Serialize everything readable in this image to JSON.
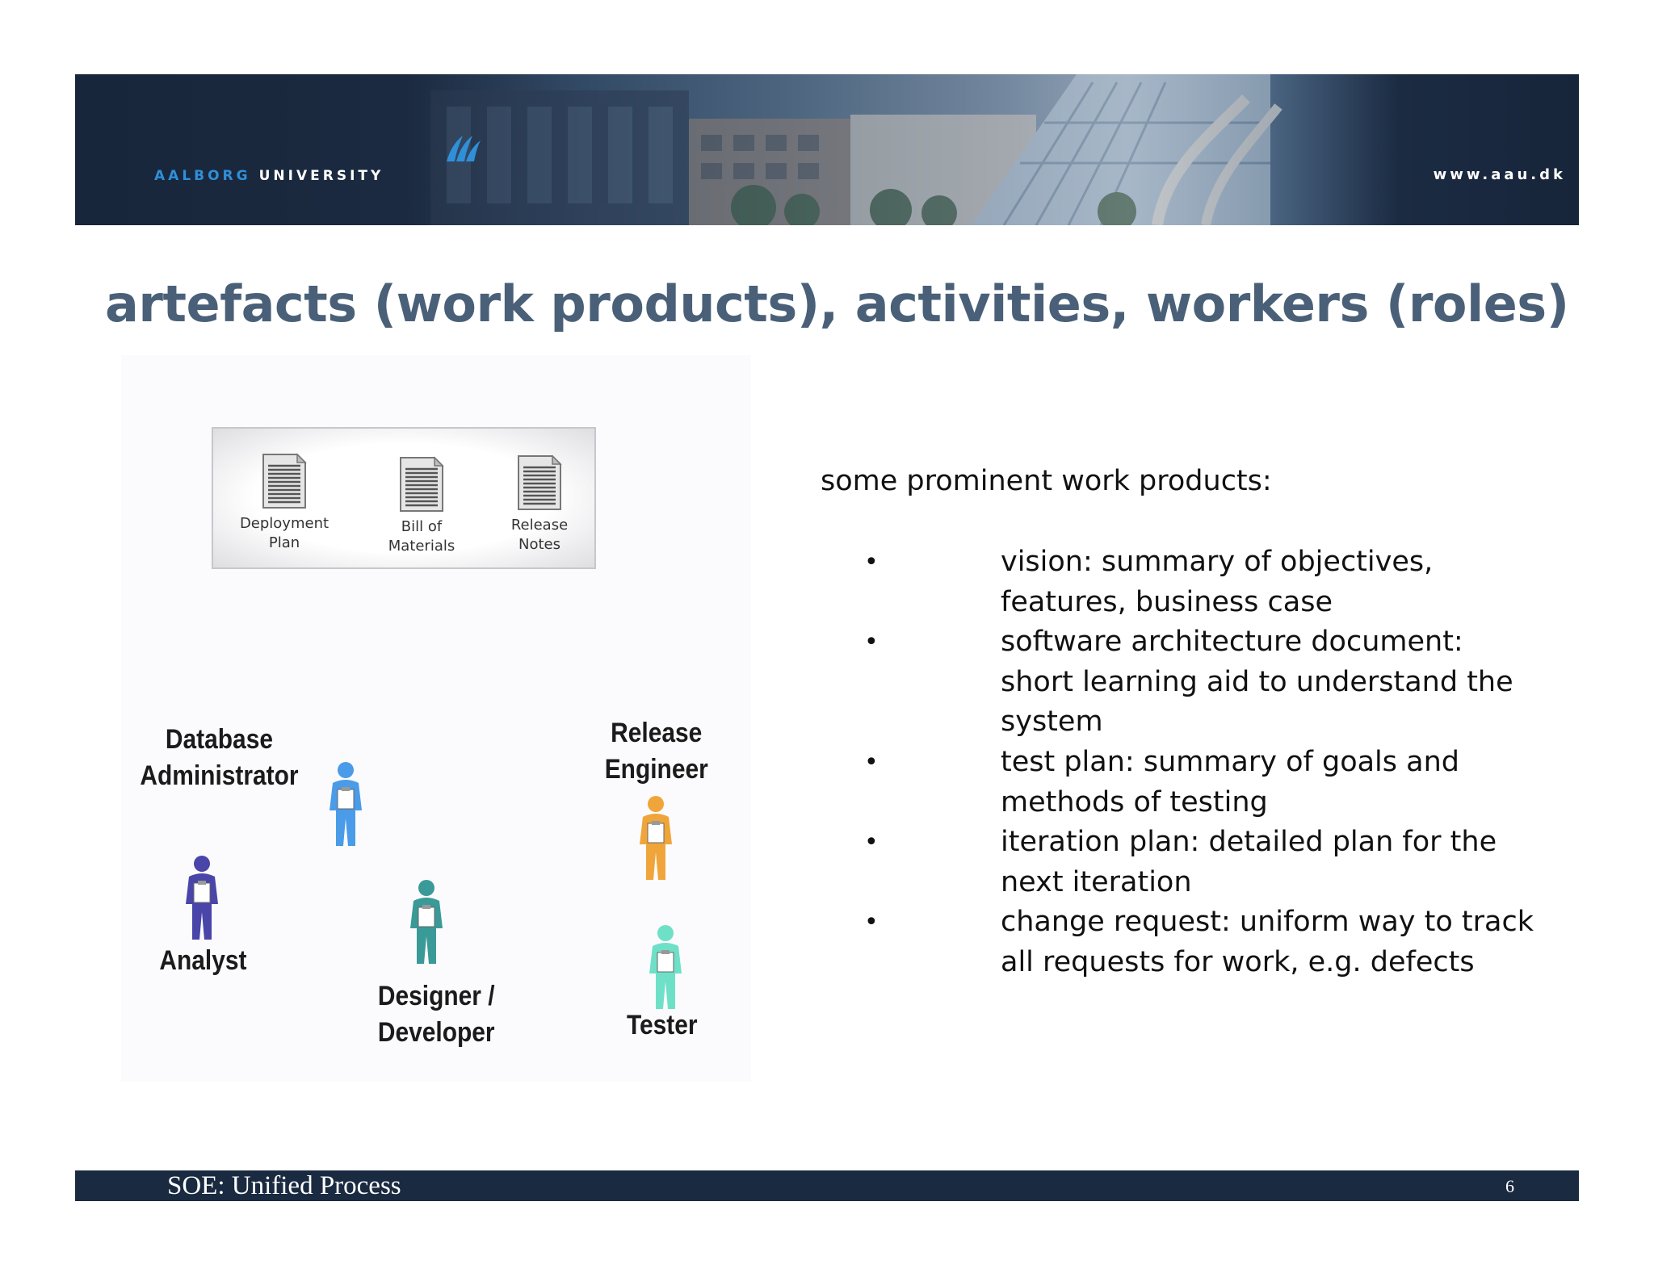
{
  "header": {
    "university_name_part1": "AALBORG",
    "university_name_part2": "UNIVERSITY",
    "website": "www.aau.dk"
  },
  "slide": {
    "title": "artefacts (work products), activities, workers (roles)",
    "artifacts": [
      {
        "line1": "Deployment",
        "line2": "Plan"
      },
      {
        "line1": "Bill of",
        "line2": "Materials"
      },
      {
        "line1": "Release",
        "line2": "Notes"
      }
    ],
    "roles": [
      {
        "line1": "Database",
        "line2": "Administrator",
        "color": "#4a9be8"
      },
      {
        "line1": "Analyst",
        "line2": "",
        "color": "#4a45a8"
      },
      {
        "line1": "Designer /",
        "line2": "Developer",
        "color": "#3a9a98"
      },
      {
        "line1": "Release",
        "line2": "Engineer",
        "color": "#f0a53a"
      },
      {
        "line1": "Tester",
        "line2": "",
        "color": "#6fe0c8"
      }
    ],
    "intro": "some prominent work products:",
    "bullets": [
      [
        "vision: summary of objectives,",
        "features, business case"
      ],
      [
        "software architecture document:",
        "short learning aid to understand the",
        "system"
      ],
      [
        "test plan: summary of goals and",
        "methods of testing"
      ],
      [
        "iteration plan: detailed plan for the",
        "next iteration"
      ],
      [
        "change request: uniform way to track",
        "all requests for work, e.g. defects"
      ]
    ],
    "bullet_symbol": "•"
  },
  "footer": {
    "title": "SOE: Unified Process",
    "page_number": "6"
  },
  "colors": {
    "banner_dark": "#1a2a40",
    "title": "#4a6078",
    "logo_blue": "#2f8fd8"
  }
}
